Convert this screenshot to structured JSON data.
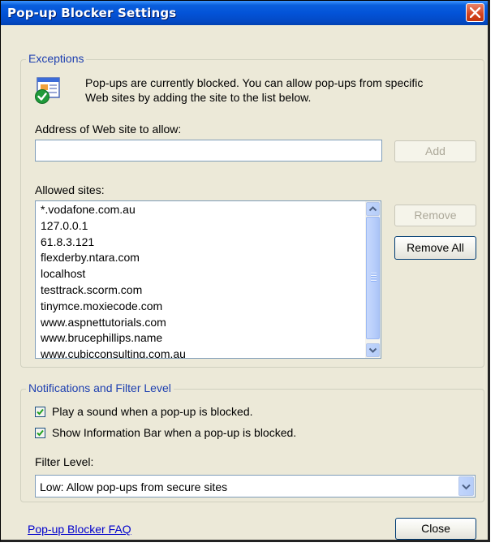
{
  "window": {
    "title": "Pop-up Blocker Settings"
  },
  "exceptions": {
    "legend": "Exceptions",
    "info_line1": "Pop-ups are currently blocked.  You can allow pop-ups from specific",
    "info_line2": "Web sites by adding the site to the list below.",
    "address_label": "Address of Web site to allow:",
    "address_value": "",
    "add_label": "Add",
    "allowed_label": "Allowed sites:",
    "allowed_sites": [
      "*.vodafone.com.au",
      "127.0.0.1",
      "61.8.3.121",
      "flexderby.ntara.com",
      "localhost",
      "testtrack.scorm.com",
      "tinymce.moxiecode.com",
      "www.aspnettutorials.com",
      "www.brucephillips.name",
      "www.cubicconsulting.com.au"
    ],
    "remove_label": "Remove",
    "remove_all_label": "Remove All"
  },
  "notifications": {
    "legend": "Notifications and Filter Level",
    "play_sound_label": "Play a sound when a pop-up is blocked.",
    "play_sound_checked": true,
    "info_bar_label": "Show Information Bar when a pop-up is blocked.",
    "info_bar_checked": true,
    "filter_label": "Filter Level:",
    "filter_value": "Low: Allow pop-ups from secure sites"
  },
  "footer": {
    "faq_link": "Pop-up Blocker FAQ",
    "close_label": "Close"
  }
}
